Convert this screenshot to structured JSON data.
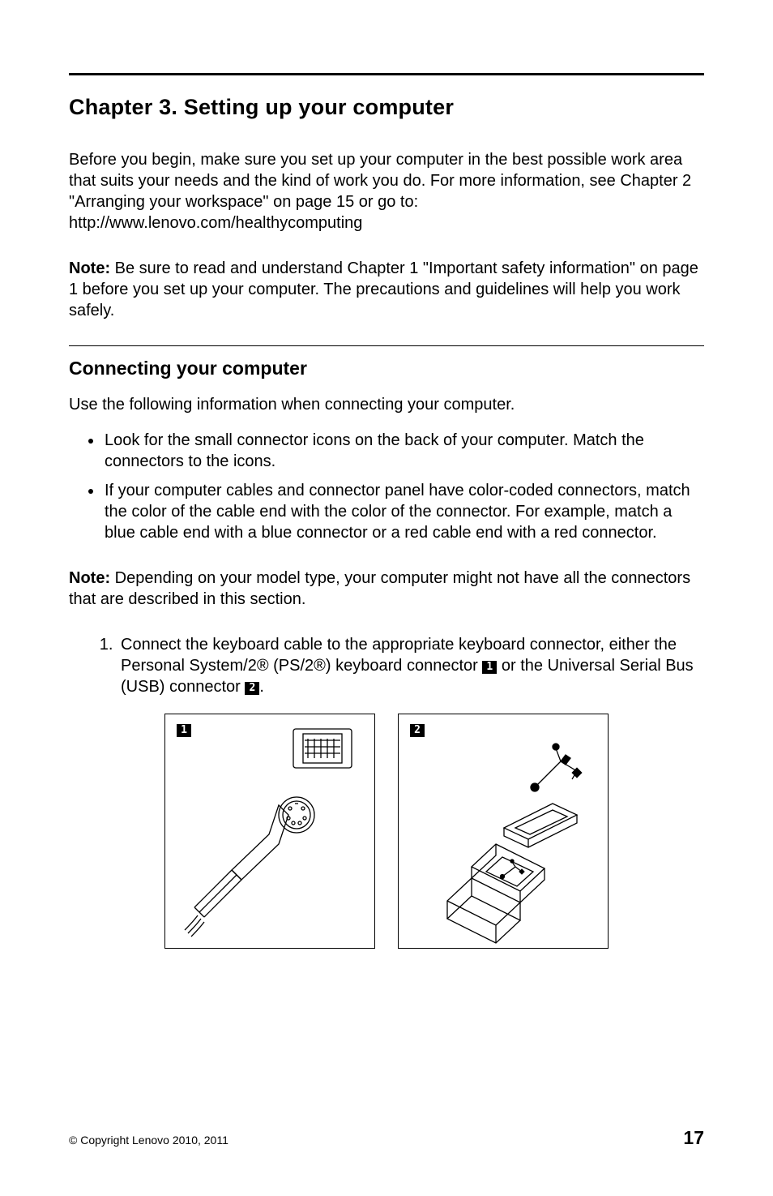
{
  "chapter_title": "Chapter 3.  Setting up your computer",
  "intro_before_link": "Before you begin, make sure you set up your computer in the best possible work area that suits your needs and the kind of work you do.  For more information, see Chapter 2 \"Arranging your workspace\" on page 15 or go to:",
  "intro_link": "http://www.lenovo.com/healthycomputing",
  "note1_label": "Note:",
  "note1_text": " Be sure to read and understand Chapter 1 \"Important safety information\" on page 1 before you set up your computer.  The precautions and guidelines will help you work safely.",
  "section_title": "Connecting your computer",
  "section_lead": "Use the following information when connecting your computer.",
  "bullets": [
    "Look for the small connector icons on the back of your computer.  Match the connectors to the icons.",
    "If your computer cables and connector panel have color-coded connectors, match the color of the cable end with the color of the connector.  For example, match a blue cable end with a blue connector or a red cable end with a red connector."
  ],
  "note2_label": "Note:",
  "note2_text": " Depending on your model type, your computer might not have all the connectors that are described in this section.",
  "step1_a": "Connect the keyboard cable to the appropriate keyboard connector, either the Personal System/2® (PS/2®) keyboard connector ",
  "step1_b": " or the Universal Serial Bus (USB) connector ",
  "step1_c": ".",
  "marker1": "1",
  "marker2": "2",
  "fig1_marker": "1",
  "fig2_marker": "2",
  "footer_copyright": "© Copyright Lenovo 2010, 2011",
  "page_number": "17"
}
